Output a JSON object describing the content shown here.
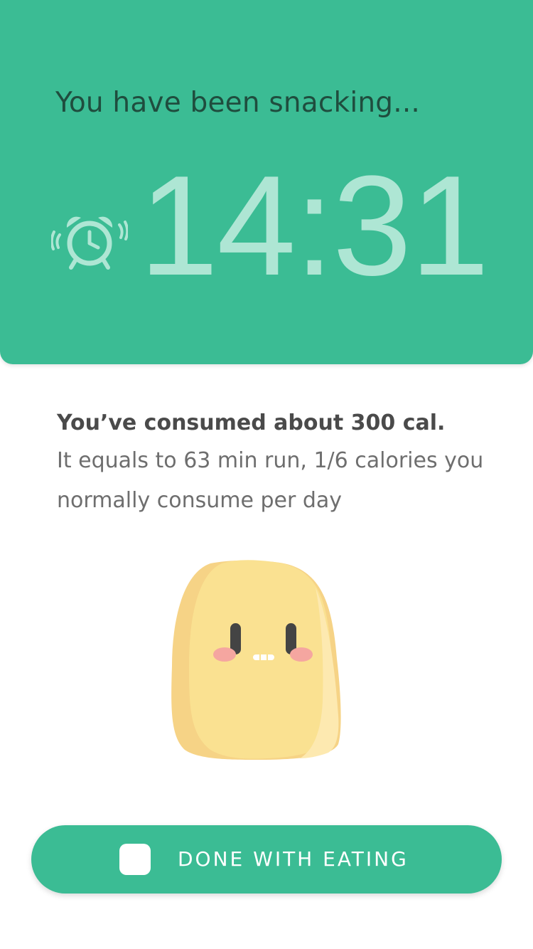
{
  "header": {
    "title": "You have been snacking...",
    "timer": "14:31",
    "alarm_icon": "alarm-clock-icon"
  },
  "summary": {
    "headline": "You’ve consumed about 300 cal.",
    "detail": "It equals to 63 min run, 1/6 calories you normally consume per day"
  },
  "mascot": {
    "icon": "potato-mascot"
  },
  "done_button": {
    "label": "DONE WITH EATING"
  },
  "colors": {
    "accent": "#3bbc94",
    "timer_text": "#aee6d4",
    "title_text": "#1f4d3e",
    "mascot_body": "#fae191",
    "mascot_shade": "#f6d386"
  }
}
